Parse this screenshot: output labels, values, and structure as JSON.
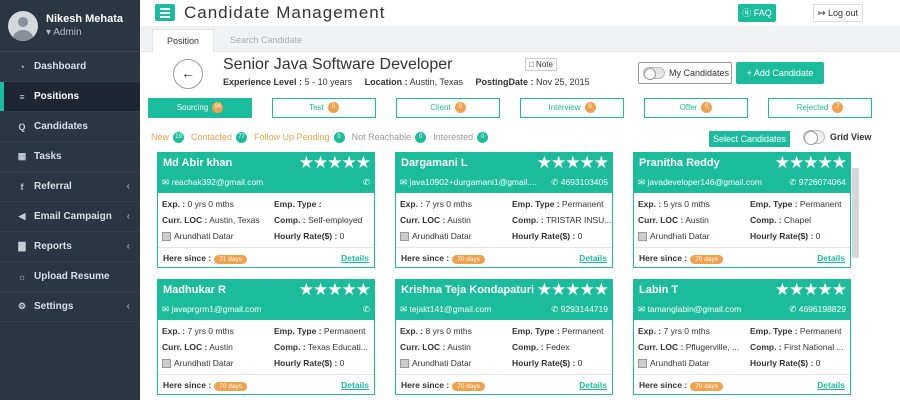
{
  "sidebar": {
    "user_name": "Nikesh Mehata",
    "user_role": "▾ Admin",
    "items": [
      {
        "label": "Dashboard",
        "icon": "dashboard-icon",
        "glyph": "◔",
        "chev": ""
      },
      {
        "label": "Positions",
        "icon": "list-icon",
        "glyph": "≡",
        "chev": ""
      },
      {
        "label": "Candidates",
        "icon": "search-icon",
        "glyph": "Q",
        "chev": ""
      },
      {
        "label": "Tasks",
        "icon": "calendar-icon",
        "glyph": "▦",
        "chev": ""
      },
      {
        "label": "Referral",
        "icon": "facebook-icon",
        "glyph": "f",
        "chev": "‹"
      },
      {
        "label": "Email Campaign",
        "icon": "megaphone-icon",
        "glyph": "◀",
        "chev": "‹"
      },
      {
        "label": "Reports",
        "icon": "bar-chart-icon",
        "glyph": "▇",
        "chev": "‹"
      },
      {
        "label": "Upload Resume",
        "icon": "upload-icon",
        "glyph": "☼",
        "chev": ""
      },
      {
        "label": "Settings",
        "icon": "gear-icon",
        "glyph": "⚙",
        "chev": "‹"
      }
    ]
  },
  "header": {
    "title": "Candidate Management",
    "faq": "ⓠ FAQ",
    "logout": "↦ Log out"
  },
  "tabs": {
    "position": "Position",
    "search": "Search Candidate"
  },
  "job": {
    "title": "Senior Java Software Developer",
    "note": "□ Note",
    "experience_label": "Experience Level :",
    "experience": "5 - 10 years",
    "location_label": "Location :",
    "location": "Austin, Texas",
    "posting_label": "PostingDate :",
    "posting_date": "Nov 25, 2015",
    "my_candidates": "My Candidates",
    "add_candidate": "+ Add Candidate"
  },
  "stages": [
    {
      "label": "Sourcing",
      "count": "96"
    },
    {
      "label": "Test",
      "count": "0"
    },
    {
      "label": "Client",
      "count": "0"
    },
    {
      "label": "Interview",
      "count": "0"
    },
    {
      "label": "Offer",
      "count": "0"
    },
    {
      "label": "Rejected",
      "count": "7"
    }
  ],
  "substages": [
    {
      "label": "New",
      "count": "19"
    },
    {
      "label": "Contacted",
      "count": "77"
    },
    {
      "label": "Follow Up Pending",
      "count": "0"
    },
    {
      "label": "Not Reachable",
      "count": "0"
    },
    {
      "label": "Interested",
      "count": "0"
    }
  ],
  "select_candidates": "Select Candidates",
  "grid_view": "Grid View",
  "card_labels": {
    "exp": "Exp. :",
    "emp_type": "Emp. Type :",
    "curr_loc": "Curr. LOC :",
    "comp": "Comp. :",
    "hourly": "Hourly Rate($) :",
    "here_since": "Here since :",
    "details": "Details"
  },
  "cards": [
    {
      "name": "Md Abir khan",
      "stars": "★★★★★",
      "email": "✉ reachak392@gmail.com",
      "phone": "✆",
      "exp": "0 yrs 0 mths",
      "emp_type": "",
      "loc": "Austin, Texas",
      "comp": "Self-employed",
      "recruiter": "Arundhati Datar",
      "rate": "0",
      "days": "71 days"
    },
    {
      "name": "Dargamani L",
      "stars": "★★★★★",
      "email": "✉ java10902+durgamani1@gmail....",
      "phone": "✆ 4693103405",
      "exp": "7 yrs 0 mths",
      "emp_type": "Permanent",
      "loc": "Austin",
      "comp": "TRISTAR INSU...",
      "recruiter": "Arundhati Datar",
      "rate": "0",
      "days": "70 days"
    },
    {
      "name": "Pranitha Reddy",
      "stars": "★★★★★",
      "email": "✉ javadeveloper146@gmail.com",
      "phone": "✆ 9726074064",
      "exp": "5 yrs 0 mths",
      "emp_type": "Permanent",
      "loc": "Austin",
      "comp": "Chapel",
      "recruiter": "Arundhati Datar",
      "rate": "0",
      "days": "70 days"
    },
    {
      "name": "Madhukar R",
      "stars": "★★★★★",
      "email": "✉ javaprgrm1@gmail.com",
      "phone": "✆",
      "exp": "7 yrs 0 mths",
      "emp_type": "Permanent",
      "loc": "Austin",
      "comp": "Texas Educati...",
      "recruiter": "Arundhati Datar",
      "rate": "0",
      "days": "70 days"
    },
    {
      "name": "Krishna Teja Kondapaturi",
      "stars": "★★★★★",
      "email": "✉ tejakt141@gmail.com",
      "phone": "✆ 9293144719",
      "exp": "8 yrs 0 mths",
      "emp_type": "Permanent",
      "loc": "Austin",
      "comp": "Fedex",
      "recruiter": "Arundhati Datar",
      "rate": "0",
      "days": "70 days"
    },
    {
      "name": "Labin T",
      "stars": "★★★★★",
      "email": "✉ tamanglabin@gmail.com",
      "phone": "✆ 4696198829",
      "exp": "7 yrs 0 mths",
      "emp_type": "Permanent",
      "loc": "Pflugerville, ...",
      "comp": "First National ...",
      "recruiter": "Arundhati Datar",
      "rate": "0",
      "days": "70 days"
    }
  ],
  "colors": {
    "accent": "#1bbc9b",
    "sidebar": "#2b3643",
    "badge": "#f0a14b"
  }
}
